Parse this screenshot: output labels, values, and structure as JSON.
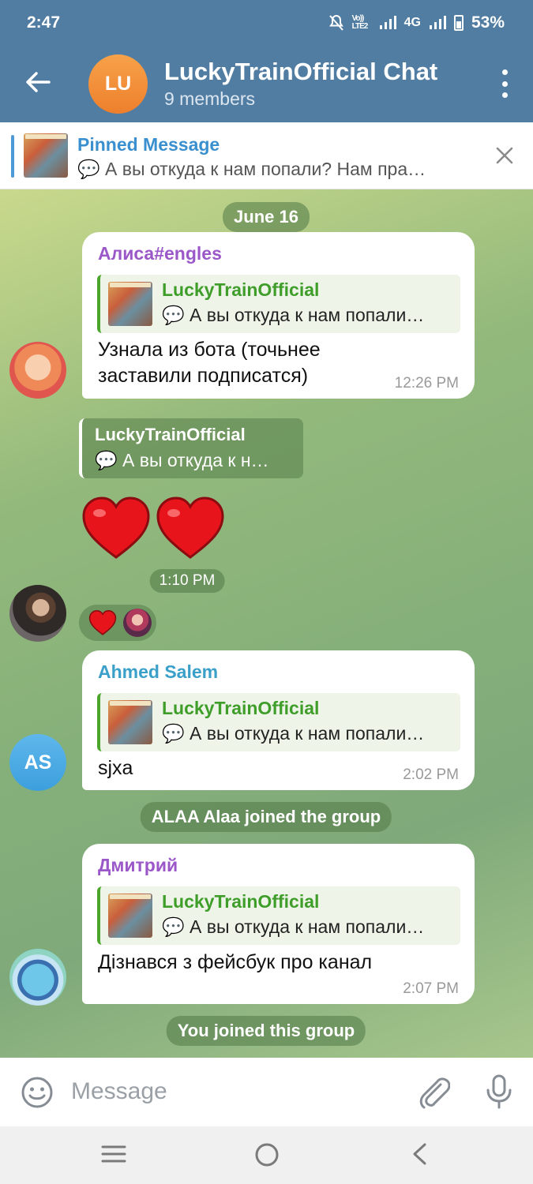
{
  "status_bar": {
    "time": "2:47",
    "network": "4G",
    "volte": "Vo)) LTE2",
    "battery": "53%"
  },
  "header": {
    "avatar_initials": "LU",
    "title": "LuckyTrainOfficial Chat",
    "subtitle": "9 members"
  },
  "pinned": {
    "title": "Pinned Message",
    "text": "💬 А вы откуда к нам попали? Нам пра…"
  },
  "date_label": "June 16",
  "messages": [
    {
      "sender": "Алиса#engles",
      "sender_color": "#9a58c8",
      "reply_name": "LuckyTrainOfficial",
      "reply_text": "💬 А вы откуда к нам попали…",
      "text_line1": "Узнала из бота (точьнее",
      "text_line2": "заставили подписатся)",
      "time": "12:26 PM"
    },
    {
      "forward_name": "LuckyTrainOfficial",
      "forward_text": "💬 А вы откуда к н…",
      "time": "1:10 PM",
      "reaction": "❤️"
    },
    {
      "sender": "Ahmed Salem",
      "sender_color": "#3aa0c9",
      "avatar_initials": "AS",
      "reply_name": "LuckyTrainOfficial",
      "reply_text": "💬 А вы откуда к нам попали…",
      "text": "sjxa",
      "time": "2:02 PM"
    },
    {
      "sender": "Дмитрий",
      "sender_color": "#9a58c8",
      "reply_name": "LuckyTrainOfficial",
      "reply_text": "💬 А вы откуда к нам попали…",
      "text": "Дізнався з фейсбук про канал",
      "time": "2:07 PM"
    }
  ],
  "service_messages": {
    "joined_alaa": "ALAA Alaa joined the group",
    "joined_you": "You joined this group"
  },
  "composer": {
    "placeholder": "Message"
  },
  "colors": {
    "header": "#517da2",
    "accent": "#3a8fcf",
    "reply_bar": "#4aa62b"
  }
}
